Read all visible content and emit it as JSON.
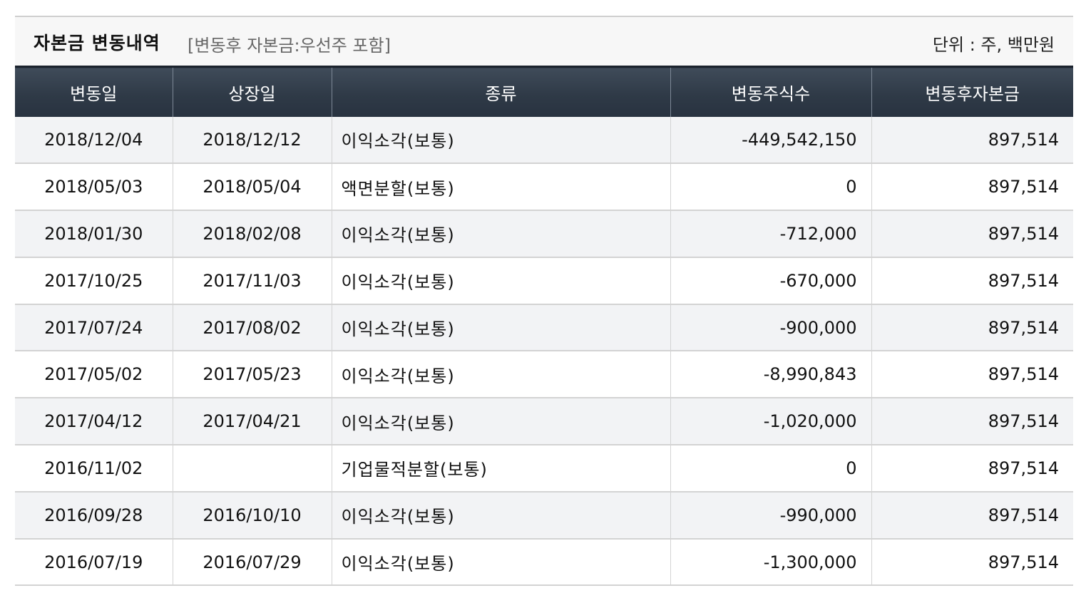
{
  "header": {
    "title": "자본금 변동내역",
    "subtitle": "[변동후 자본금:우선주 포함]",
    "unit": "단위 : 주, 백만원"
  },
  "table": {
    "columns": [
      "변동일",
      "상장일",
      "종류",
      "변동주식수",
      "변동후자본금"
    ],
    "rows": [
      {
        "change_date": "2018/12/04",
        "listing_date": "2018/12/12",
        "type": "이익소각(보통)",
        "shares_changed": "-449,542,150",
        "capital_after": "897,514"
      },
      {
        "change_date": "2018/05/03",
        "listing_date": "2018/05/04",
        "type": "액면분할(보통)",
        "shares_changed": "0",
        "capital_after": "897,514"
      },
      {
        "change_date": "2018/01/30",
        "listing_date": "2018/02/08",
        "type": "이익소각(보통)",
        "shares_changed": "-712,000",
        "capital_after": "897,514"
      },
      {
        "change_date": "2017/10/25",
        "listing_date": "2017/11/03",
        "type": "이익소각(보통)",
        "shares_changed": "-670,000",
        "capital_after": "897,514"
      },
      {
        "change_date": "2017/07/24",
        "listing_date": "2017/08/02",
        "type": "이익소각(보통)",
        "shares_changed": "-900,000",
        "capital_after": "897,514"
      },
      {
        "change_date": "2017/05/02",
        "listing_date": "2017/05/23",
        "type": "이익소각(보통)",
        "shares_changed": "-8,990,843",
        "capital_after": "897,514"
      },
      {
        "change_date": "2017/04/12",
        "listing_date": "2017/04/21",
        "type": "이익소각(보통)",
        "shares_changed": "-1,020,000",
        "capital_after": "897,514"
      },
      {
        "change_date": "2016/11/02",
        "listing_date": "",
        "type": "기업물적분할(보통)",
        "shares_changed": "0",
        "capital_after": "897,514"
      },
      {
        "change_date": "2016/09/28",
        "listing_date": "2016/10/10",
        "type": "이익소각(보통)",
        "shares_changed": "-990,000",
        "capital_after": "897,514"
      },
      {
        "change_date": "2016/07/19",
        "listing_date": "2016/07/29",
        "type": "이익소각(보통)",
        "shares_changed": "-1,300,000",
        "capital_after": "897,514"
      }
    ]
  },
  "colors": {
    "header_bg": "#2f3a47",
    "row_alt_bg": "#f2f3f5",
    "border": "#d3d3d3"
  }
}
